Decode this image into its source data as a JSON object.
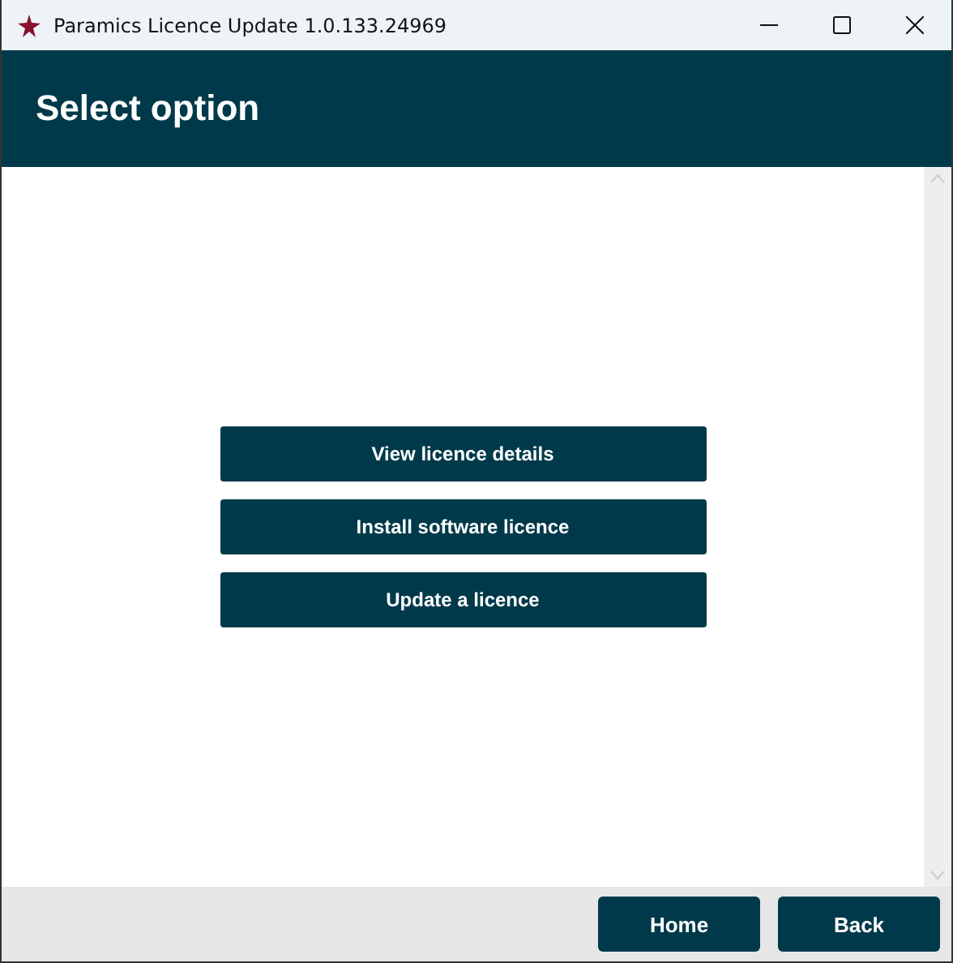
{
  "window": {
    "title": "Paramics Licence Update 1.0.133.24969"
  },
  "header": {
    "title": "Select option"
  },
  "options": [
    "View licence details",
    "Install software licence",
    "Update a licence"
  ],
  "footer": {
    "buttons": [
      "Home",
      "Back"
    ]
  }
}
